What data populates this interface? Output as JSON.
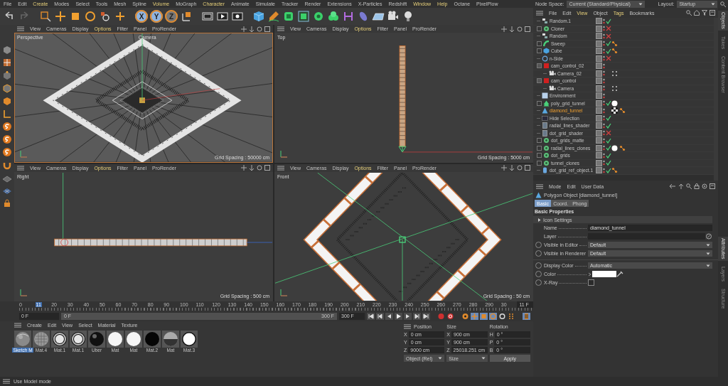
{
  "menu": [
    {
      "label": "File",
      "highlighted": false
    },
    {
      "label": "Edit",
      "highlighted": false
    },
    {
      "label": "Create",
      "highlighted": true
    },
    {
      "label": "Modes",
      "highlighted": false
    },
    {
      "label": "Select",
      "highlighted": false
    },
    {
      "label": "Tools",
      "highlighted": false
    },
    {
      "label": "Mesh",
      "highlighted": false
    },
    {
      "label": "Spline",
      "highlighted": false
    },
    {
      "label": "Volume",
      "highlighted": true
    },
    {
      "label": "MoGraph",
      "highlighted": false
    },
    {
      "label": "Character",
      "highlighted": true
    },
    {
      "label": "Animate",
      "highlighted": false
    },
    {
      "label": "Simulate",
      "highlighted": false
    },
    {
      "label": "Tracker",
      "highlighted": false
    },
    {
      "label": "Render",
      "highlighted": false
    },
    {
      "label": "Extensions",
      "highlighted": false
    },
    {
      "label": "X-Particles",
      "highlighted": false
    },
    {
      "label": "Redshift",
      "highlighted": false
    },
    {
      "label": "Window",
      "highlighted": true
    },
    {
      "label": "Help",
      "highlighted": true
    },
    {
      "label": "Octane",
      "highlighted": false
    },
    {
      "label": "PixelPlow",
      "highlighted": false
    }
  ],
  "axes": [
    {
      "label": "X",
      "selected": true
    },
    {
      "label": "Y",
      "selected": true
    },
    {
      "label": "Z",
      "selected": false
    }
  ],
  "viewports": [
    {
      "kind": "perspective",
      "active": true,
      "label": "Perspective",
      "camera": "Camera",
      "grid": "Grid Spacing : 50000 cm",
      "menus": [
        {
          "label": "View",
          "highlighted": false
        },
        {
          "label": "Cameras",
          "highlighted": false
        },
        {
          "label": "Display",
          "highlighted": false
        },
        {
          "label": "Options",
          "highlighted": true
        },
        {
          "label": "Filter",
          "highlighted": false
        },
        {
          "label": "Panel",
          "highlighted": false
        },
        {
          "label": "ProRender",
          "highlighted": false
        }
      ]
    },
    {
      "kind": "top",
      "active": false,
      "label": "Top",
      "grid": "Grid Spacing : 5000 cm",
      "menus": [
        {
          "label": "View",
          "highlighted": false
        },
        {
          "label": "Cameras",
          "highlighted": false
        },
        {
          "label": "Display",
          "highlighted": false
        },
        {
          "label": "Options",
          "highlighted": true
        },
        {
          "label": "Filter",
          "highlighted": false
        },
        {
          "label": "Panel",
          "highlighted": false
        },
        {
          "label": "ProRender",
          "highlighted": false
        }
      ]
    },
    {
      "kind": "right",
      "active": false,
      "label": "Right",
      "grid": "Grid Spacing : 500 cm",
      "menus": [
        {
          "label": "View",
          "highlighted": false
        },
        {
          "label": "Cameras",
          "highlighted": false
        },
        {
          "label": "Display",
          "highlighted": false
        },
        {
          "label": "Options",
          "highlighted": true
        },
        {
          "label": "Filter",
          "highlighted": false
        },
        {
          "label": "Panel",
          "highlighted": false
        },
        {
          "label": "ProRender",
          "highlighted": false
        }
      ]
    },
    {
      "kind": "front",
      "active": false,
      "label": "Front",
      "grid": "Grid Spacing : 50 cm",
      "menus": [
        {
          "label": "View",
          "highlighted": false
        },
        {
          "label": "Cameras",
          "highlighted": false
        },
        {
          "label": "Display",
          "highlighted": false
        },
        {
          "label": "Options",
          "highlighted": true
        },
        {
          "label": "Filter",
          "highlighted": false
        },
        {
          "label": "Panel",
          "highlighted": false
        },
        {
          "label": "ProRender",
          "highlighted": false
        }
      ]
    }
  ],
  "timeline": {
    "frames": [
      {
        "label": "0",
        "selected": false
      },
      {
        "label": "11",
        "selected": true
      },
      {
        "label": "20",
        "selected": false
      },
      {
        "label": "30",
        "selected": false
      },
      {
        "label": "40",
        "selected": false
      },
      {
        "label": "50",
        "selected": false
      },
      {
        "label": "60",
        "selected": false
      },
      {
        "label": "70",
        "selected": false
      },
      {
        "label": "80",
        "selected": false
      },
      {
        "label": "90",
        "selected": false
      },
      {
        "label": "100",
        "selected": false
      },
      {
        "label": "110",
        "selected": false
      },
      {
        "label": "120",
        "selected": false
      },
      {
        "label": "130",
        "selected": false
      },
      {
        "label": "140",
        "selected": false
      },
      {
        "label": "150",
        "selected": false
      },
      {
        "label": "160",
        "selected": false
      },
      {
        "label": "170",
        "selected": false
      },
      {
        "label": "180",
        "selected": false
      },
      {
        "label": "190",
        "selected": false
      },
      {
        "label": "200",
        "selected": false
      },
      {
        "label": "210",
        "selected": false
      },
      {
        "label": "220",
        "selected": false
      },
      {
        "label": "230",
        "selected": false
      },
      {
        "label": "240",
        "selected": false
      },
      {
        "label": "250",
        "selected": false
      },
      {
        "label": "260",
        "selected": false
      },
      {
        "label": "270",
        "selected": false
      },
      {
        "label": "280",
        "selected": false
      },
      {
        "label": "290",
        "selected": false
      },
      {
        "label": "30",
        "selected": false
      }
    ],
    "current": "11 F",
    "start": "0 F",
    "range_start": "0 F",
    "range_end": "300 F",
    "end": "300 F"
  },
  "materials": {
    "menus": [
      "Create",
      "Edit",
      "View",
      "Select",
      "Material",
      "Texture"
    ],
    "items": [
      {
        "name": "Sketch M",
        "kind": "sketch",
        "selected": true
      },
      {
        "name": "Mat.4",
        "kind": "grid",
        "selected": false
      },
      {
        "name": "Mat.1",
        "kind": "glow",
        "selected": false
      },
      {
        "name": "Mat.1",
        "kind": "glow",
        "selected": false
      },
      {
        "name": "Uber",
        "kind": "dark",
        "selected": false
      },
      {
        "name": "Mat",
        "kind": "white",
        "selected": false
      },
      {
        "name": "Mat",
        "kind": "white",
        "selected": false
      },
      {
        "name": "Mat.2",
        "kind": "black",
        "selected": false
      },
      {
        "name": "Mat",
        "kind": "gradient",
        "selected": false
      },
      {
        "name": "Mat.3",
        "kind": "ring",
        "selected": false
      }
    ]
  },
  "coordinates": {
    "headers": [
      "Position",
      "Size",
      "Rotation"
    ],
    "rows": [
      [
        {
          "axis": "X",
          "value": "0 cm"
        },
        {
          "axis": "X",
          "value": "900 cm"
        },
        {
          "axis": "H",
          "value": "0 °"
        }
      ],
      [
        {
          "axis": "Y",
          "value": "0 cm"
        },
        {
          "axis": "Y",
          "value": "900 cm"
        },
        {
          "axis": "P",
          "value": "0 °"
        }
      ],
      [
        {
          "axis": "Z",
          "value": "9000 cm"
        },
        {
          "axis": "Z",
          "value": "25018.251 cm"
        },
        {
          "axis": "B",
          "value": "0 °"
        }
      ]
    ],
    "mode": "Object (Rel)",
    "size_mode": "Size",
    "apply": "Apply"
  },
  "status_bar": "Use Model mode",
  "node_space": {
    "label": "Node Space:",
    "value": "Current (Standard/Physical)",
    "layout_label": "Layout:",
    "layout": "Startup"
  },
  "object_manager": {
    "menus": [
      {
        "label": "File",
        "highlighted": false
      },
      {
        "label": "Edit",
        "highlighted": false
      },
      {
        "label": "View",
        "highlighted": true
      },
      {
        "label": "Object",
        "highlighted": false
      },
      {
        "label": "Tags",
        "highlighted": true
      },
      {
        "label": "Bookmarks",
        "highlighted": false
      }
    ],
    "objects": [
      {
        "name": "Random.1",
        "kind": "effector",
        "selected": false,
        "enabled": true
      },
      {
        "name": "Cloner",
        "kind": "cloner",
        "selected": false,
        "enabled": false,
        "expanded": false
      },
      {
        "name": "Random",
        "kind": "effector",
        "selected": false,
        "enabled": false
      },
      {
        "name": "Sweep",
        "kind": "sweep",
        "selected": false,
        "enabled": true,
        "expanded": false,
        "tags": [
          {
            "kind": "phong"
          }
        ]
      },
      {
        "name": "Cube",
        "kind": "cube",
        "selected": false,
        "enabled": true,
        "expanded": false,
        "tags": [
          {
            "kind": "phong"
          }
        ]
      },
      {
        "name": "n-Side",
        "kind": "spline",
        "selected": false,
        "enabled": false
      },
      {
        "name": "cam_control_02",
        "kind": "null",
        "selected": false,
        "expanded": true,
        "children": [
          {
            "name": "Camera_02",
            "kind": "camera",
            "selected": false,
            "tags": [
              {
                "kind": "protection"
              }
            ]
          }
        ]
      },
      {
        "name": "cam_control",
        "kind": "null",
        "selected": false,
        "expanded": true,
        "children": [
          {
            "name": "Camera",
            "kind": "camera",
            "selected": false,
            "tags": [
              {
                "kind": "protection"
              }
            ]
          }
        ]
      },
      {
        "name": "Environment",
        "kind": "environment",
        "selected": false
      },
      {
        "name": "poly_grid_tunnel",
        "kind": "cloner-green",
        "selected": false,
        "enabled": true,
        "expanded": false,
        "tags": [
          {
            "kind": "material"
          }
        ]
      },
      {
        "name": "diamond_tunnel",
        "kind": "polygon",
        "selected": true,
        "tags": [
          {
            "kind": "texture"
          },
          {
            "kind": "phong"
          }
        ]
      },
      {
        "name": "Hide Selection",
        "kind": "selection",
        "selected": false,
        "enabled": true
      },
      {
        "name": "radial_lines_shader",
        "kind": "shader",
        "selected": false,
        "enabled": true
      },
      {
        "name": "dot_grid_shader",
        "kind": "shader",
        "selected": false,
        "enabled": false
      },
      {
        "name": "dot_grids_matte",
        "kind": "cloner",
        "selected": false,
        "enabled": true,
        "expanded": false
      },
      {
        "name": "radial_lines_clones",
        "kind": "cloner",
        "selected": false,
        "enabled": true,
        "expanded": false,
        "tags": [
          {
            "kind": "material"
          },
          {
            "kind": "phong"
          }
        ]
      },
      {
        "name": "dot_grids",
        "kind": "cloner",
        "selected": false,
        "enabled": true,
        "expanded": false
      },
      {
        "name": "tunnel_clones",
        "kind": "cloner",
        "selected": false,
        "enabled": true,
        "expanded": false
      },
      {
        "name": "dot_grid_ref_object.1",
        "kind": "cylinder",
        "selected": false,
        "enabled": true,
        "tags": [
          {
            "kind": "phong"
          }
        ]
      }
    ]
  },
  "attributes": {
    "menus": [
      "Mode",
      "Edit",
      "User Data"
    ],
    "title": "Polygon Object [diamond_tunnel]",
    "tabs": [
      {
        "label": "Basic",
        "selected": true
      },
      {
        "label": "Coord.",
        "selected": false
      },
      {
        "label": "Phong",
        "selected": false
      }
    ],
    "section": "Basic Properties",
    "group": {
      "label": "Icon Settings",
      "expanded": false
    },
    "fields": [
      {
        "kind": "text",
        "label": "Name",
        "value": "diamond_tunnel"
      },
      {
        "kind": "link",
        "label": "Layer"
      },
      {
        "kind": "select",
        "label": "Visible in Editor",
        "value": "Default"
      },
      {
        "kind": "select",
        "label": "Visible in Renderer",
        "value": "Default"
      },
      {
        "kind": "select",
        "label": "Display Color",
        "value": "Automatic",
        "gap": true
      },
      {
        "kind": "color",
        "label": "Color",
        "color": "#ffffff"
      },
      {
        "kind": "checkbox",
        "label": "X-Ray",
        "checked": false
      }
    ]
  },
  "side_tabs_top": [
    {
      "label": "Objects",
      "selected": true
    },
    {
      "label": "Takes",
      "selected": false
    },
    {
      "label": "Content Browser",
      "selected": false
    }
  ],
  "side_tabs_bottom": [
    {
      "label": "Attributes",
      "selected": true
    },
    {
      "label": "Layers",
      "selected": false
    },
    {
      "label": "Structure",
      "selected": false
    }
  ]
}
